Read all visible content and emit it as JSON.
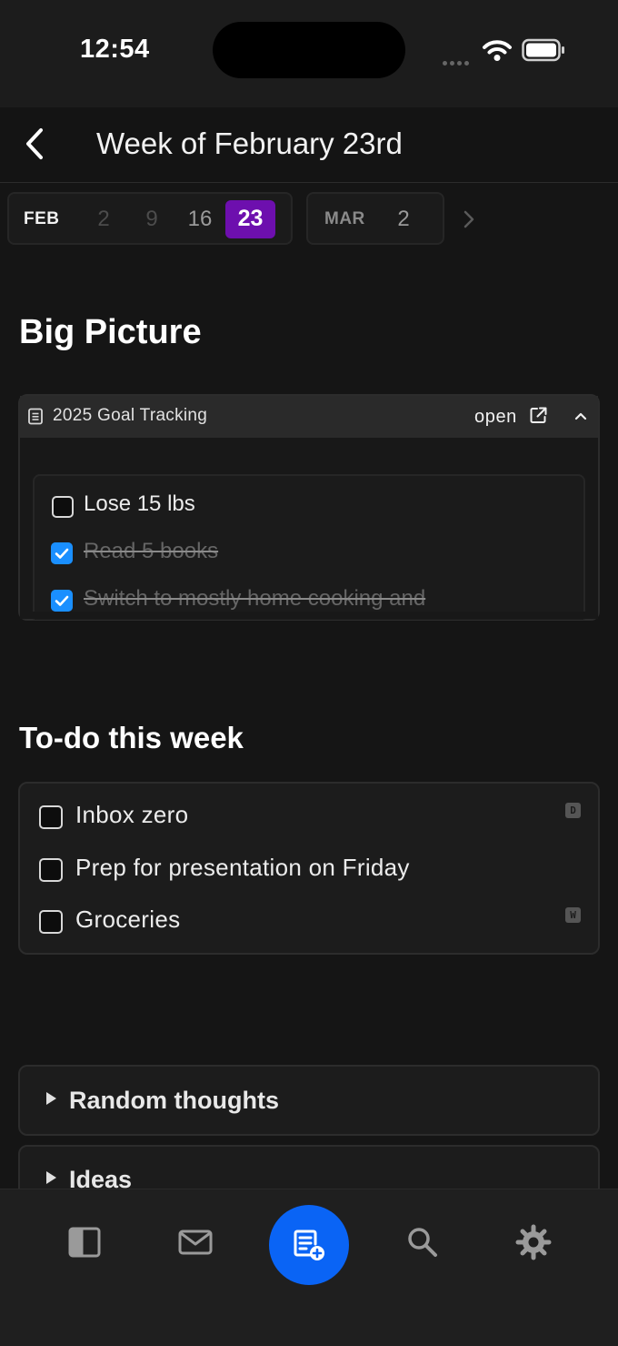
{
  "status_bar": {
    "time": "12:54"
  },
  "header": {
    "title": "Week of February 23rd"
  },
  "week_picker": {
    "months": [
      {
        "label": "FEB",
        "days": [
          "2",
          "9",
          "16",
          "23"
        ],
        "selected": "23"
      },
      {
        "label": "MAR",
        "days": [
          "2"
        ]
      }
    ]
  },
  "big_picture": {
    "heading": "Big Picture",
    "embed_title": "2025 Goal Tracking",
    "open_label": "open",
    "items": [
      {
        "text": "Lose 15 lbs",
        "checked": false
      },
      {
        "text": "Read 5 books",
        "checked": true
      },
      {
        "text": "Switch to mostly home cooking and",
        "checked": true
      }
    ]
  },
  "todo": {
    "heading": "To-do this week",
    "items": [
      {
        "text": "Inbox zero",
        "checked": false,
        "tag": "D"
      },
      {
        "text": "Prep for presentation on Friday",
        "checked": false,
        "tag": ""
      },
      {
        "text": "Groceries",
        "checked": false,
        "tag": "W"
      }
    ]
  },
  "toggles": [
    {
      "label": "Random thoughts"
    },
    {
      "label": "Ideas"
    }
  ],
  "colors": {
    "accent_selected_day": "#6d0fae",
    "checkbox_checked": "#1a8fff",
    "fab": "#0a64f5",
    "background": "#151515"
  },
  "bottom_nav": {
    "icons": [
      "sidebar-icon",
      "mail-icon",
      "new-note-icon",
      "search-icon",
      "gear-icon"
    ]
  }
}
